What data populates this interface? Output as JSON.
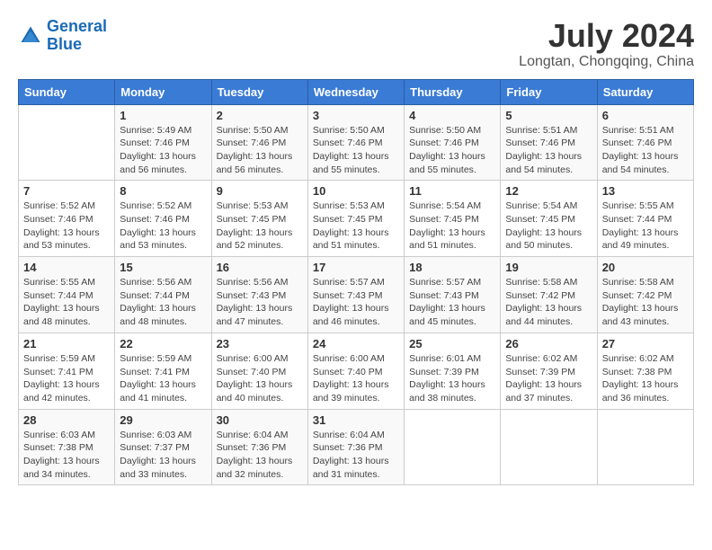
{
  "logo": {
    "name_general": "General",
    "name_blue": "Blue"
  },
  "header": {
    "month_year": "July 2024",
    "location": "Longtan, Chongqing, China"
  },
  "weekdays": [
    "Sunday",
    "Monday",
    "Tuesday",
    "Wednesday",
    "Thursday",
    "Friday",
    "Saturday"
  ],
  "weeks": [
    [
      {
        "day": "",
        "sunrise": "",
        "sunset": "",
        "daylight": ""
      },
      {
        "day": "1",
        "sunrise": "Sunrise: 5:49 AM",
        "sunset": "Sunset: 7:46 PM",
        "daylight": "Daylight: 13 hours and 56 minutes."
      },
      {
        "day": "2",
        "sunrise": "Sunrise: 5:50 AM",
        "sunset": "Sunset: 7:46 PM",
        "daylight": "Daylight: 13 hours and 56 minutes."
      },
      {
        "day": "3",
        "sunrise": "Sunrise: 5:50 AM",
        "sunset": "Sunset: 7:46 PM",
        "daylight": "Daylight: 13 hours and 55 minutes."
      },
      {
        "day": "4",
        "sunrise": "Sunrise: 5:50 AM",
        "sunset": "Sunset: 7:46 PM",
        "daylight": "Daylight: 13 hours and 55 minutes."
      },
      {
        "day": "5",
        "sunrise": "Sunrise: 5:51 AM",
        "sunset": "Sunset: 7:46 PM",
        "daylight": "Daylight: 13 hours and 54 minutes."
      },
      {
        "day": "6",
        "sunrise": "Sunrise: 5:51 AM",
        "sunset": "Sunset: 7:46 PM",
        "daylight": "Daylight: 13 hours and 54 minutes."
      }
    ],
    [
      {
        "day": "7",
        "sunrise": "Sunrise: 5:52 AM",
        "sunset": "Sunset: 7:46 PM",
        "daylight": "Daylight: 13 hours and 53 minutes."
      },
      {
        "day": "8",
        "sunrise": "Sunrise: 5:52 AM",
        "sunset": "Sunset: 7:46 PM",
        "daylight": "Daylight: 13 hours and 53 minutes."
      },
      {
        "day": "9",
        "sunrise": "Sunrise: 5:53 AM",
        "sunset": "Sunset: 7:45 PM",
        "daylight": "Daylight: 13 hours and 52 minutes."
      },
      {
        "day": "10",
        "sunrise": "Sunrise: 5:53 AM",
        "sunset": "Sunset: 7:45 PM",
        "daylight": "Daylight: 13 hours and 51 minutes."
      },
      {
        "day": "11",
        "sunrise": "Sunrise: 5:54 AM",
        "sunset": "Sunset: 7:45 PM",
        "daylight": "Daylight: 13 hours and 51 minutes."
      },
      {
        "day": "12",
        "sunrise": "Sunrise: 5:54 AM",
        "sunset": "Sunset: 7:45 PM",
        "daylight": "Daylight: 13 hours and 50 minutes."
      },
      {
        "day": "13",
        "sunrise": "Sunrise: 5:55 AM",
        "sunset": "Sunset: 7:44 PM",
        "daylight": "Daylight: 13 hours and 49 minutes."
      }
    ],
    [
      {
        "day": "14",
        "sunrise": "Sunrise: 5:55 AM",
        "sunset": "Sunset: 7:44 PM",
        "daylight": "Daylight: 13 hours and 48 minutes."
      },
      {
        "day": "15",
        "sunrise": "Sunrise: 5:56 AM",
        "sunset": "Sunset: 7:44 PM",
        "daylight": "Daylight: 13 hours and 48 minutes."
      },
      {
        "day": "16",
        "sunrise": "Sunrise: 5:56 AM",
        "sunset": "Sunset: 7:43 PM",
        "daylight": "Daylight: 13 hours and 47 minutes."
      },
      {
        "day": "17",
        "sunrise": "Sunrise: 5:57 AM",
        "sunset": "Sunset: 7:43 PM",
        "daylight": "Daylight: 13 hours and 46 minutes."
      },
      {
        "day": "18",
        "sunrise": "Sunrise: 5:57 AM",
        "sunset": "Sunset: 7:43 PM",
        "daylight": "Daylight: 13 hours and 45 minutes."
      },
      {
        "day": "19",
        "sunrise": "Sunrise: 5:58 AM",
        "sunset": "Sunset: 7:42 PM",
        "daylight": "Daylight: 13 hours and 44 minutes."
      },
      {
        "day": "20",
        "sunrise": "Sunrise: 5:58 AM",
        "sunset": "Sunset: 7:42 PM",
        "daylight": "Daylight: 13 hours and 43 minutes."
      }
    ],
    [
      {
        "day": "21",
        "sunrise": "Sunrise: 5:59 AM",
        "sunset": "Sunset: 7:41 PM",
        "daylight": "Daylight: 13 hours and 42 minutes."
      },
      {
        "day": "22",
        "sunrise": "Sunrise: 5:59 AM",
        "sunset": "Sunset: 7:41 PM",
        "daylight": "Daylight: 13 hours and 41 minutes."
      },
      {
        "day": "23",
        "sunrise": "Sunrise: 6:00 AM",
        "sunset": "Sunset: 7:40 PM",
        "daylight": "Daylight: 13 hours and 40 minutes."
      },
      {
        "day": "24",
        "sunrise": "Sunrise: 6:00 AM",
        "sunset": "Sunset: 7:40 PM",
        "daylight": "Daylight: 13 hours and 39 minutes."
      },
      {
        "day": "25",
        "sunrise": "Sunrise: 6:01 AM",
        "sunset": "Sunset: 7:39 PM",
        "daylight": "Daylight: 13 hours and 38 minutes."
      },
      {
        "day": "26",
        "sunrise": "Sunrise: 6:02 AM",
        "sunset": "Sunset: 7:39 PM",
        "daylight": "Daylight: 13 hours and 37 minutes."
      },
      {
        "day": "27",
        "sunrise": "Sunrise: 6:02 AM",
        "sunset": "Sunset: 7:38 PM",
        "daylight": "Daylight: 13 hours and 36 minutes."
      }
    ],
    [
      {
        "day": "28",
        "sunrise": "Sunrise: 6:03 AM",
        "sunset": "Sunset: 7:38 PM",
        "daylight": "Daylight: 13 hours and 34 minutes."
      },
      {
        "day": "29",
        "sunrise": "Sunrise: 6:03 AM",
        "sunset": "Sunset: 7:37 PM",
        "daylight": "Daylight: 13 hours and 33 minutes."
      },
      {
        "day": "30",
        "sunrise": "Sunrise: 6:04 AM",
        "sunset": "Sunset: 7:36 PM",
        "daylight": "Daylight: 13 hours and 32 minutes."
      },
      {
        "day": "31",
        "sunrise": "Sunrise: 6:04 AM",
        "sunset": "Sunset: 7:36 PM",
        "daylight": "Daylight: 13 hours and 31 minutes."
      },
      {
        "day": "",
        "sunrise": "",
        "sunset": "",
        "daylight": ""
      },
      {
        "day": "",
        "sunrise": "",
        "sunset": "",
        "daylight": ""
      },
      {
        "day": "",
        "sunrise": "",
        "sunset": "",
        "daylight": ""
      }
    ]
  ]
}
